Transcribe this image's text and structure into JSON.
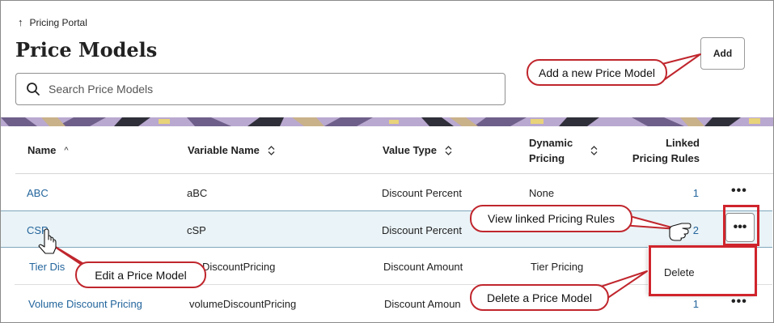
{
  "breadcrumb": {
    "label": "Pricing Portal",
    "icon": "arrow-up-icon"
  },
  "page": {
    "title": "Price Models"
  },
  "search": {
    "placeholder": "Search Price Models"
  },
  "toolbar": {
    "add_label": "Add"
  },
  "table": {
    "columns": [
      {
        "label": "Name",
        "sort_icon": "sort-ascending-icon"
      },
      {
        "label": "Variable Name",
        "sort_icon": "sort-icon"
      },
      {
        "label": "Value Type",
        "sort_icon": "sort-icon"
      },
      {
        "label_line1": "Dynamic",
        "label_line2": "Pricing",
        "sort_icon": "sort-icon"
      },
      {
        "label_line1": "Linked",
        "label_line2": "Pricing Rules"
      }
    ],
    "rows": [
      {
        "name": "ABC",
        "variable": "aBC",
        "value_type": "Discount Percent",
        "dynamic": "None",
        "linked": "1"
      },
      {
        "name": "CSP",
        "variable": "cSP",
        "value_type": "Discount Percent",
        "dynamic": "",
        "linked": "2"
      },
      {
        "name": "Tier Discount Pricing",
        "name_visible": "Tier Dis",
        "variable": "DiscountPricing",
        "value_type": "Discount Amount",
        "dynamic": "Tier Pricing",
        "linked": ""
      },
      {
        "name": "Volume Discount Pricing",
        "variable": "volumeDiscountPricing",
        "value_type": "Discount Amoun",
        "dynamic": "",
        "linked": "1"
      }
    ],
    "more_label": "•••"
  },
  "row_menu": {
    "items": [
      "Delete"
    ]
  },
  "callouts": {
    "add": "Add a new Price Model",
    "view_rules": "View linked Pricing Rules",
    "edit": "Edit a Price Model",
    "delete": "Delete a Price Model"
  },
  "colors": {
    "link": "#23659c",
    "callout_border": "#c0262d",
    "selected_row": "#eaf3f7"
  }
}
